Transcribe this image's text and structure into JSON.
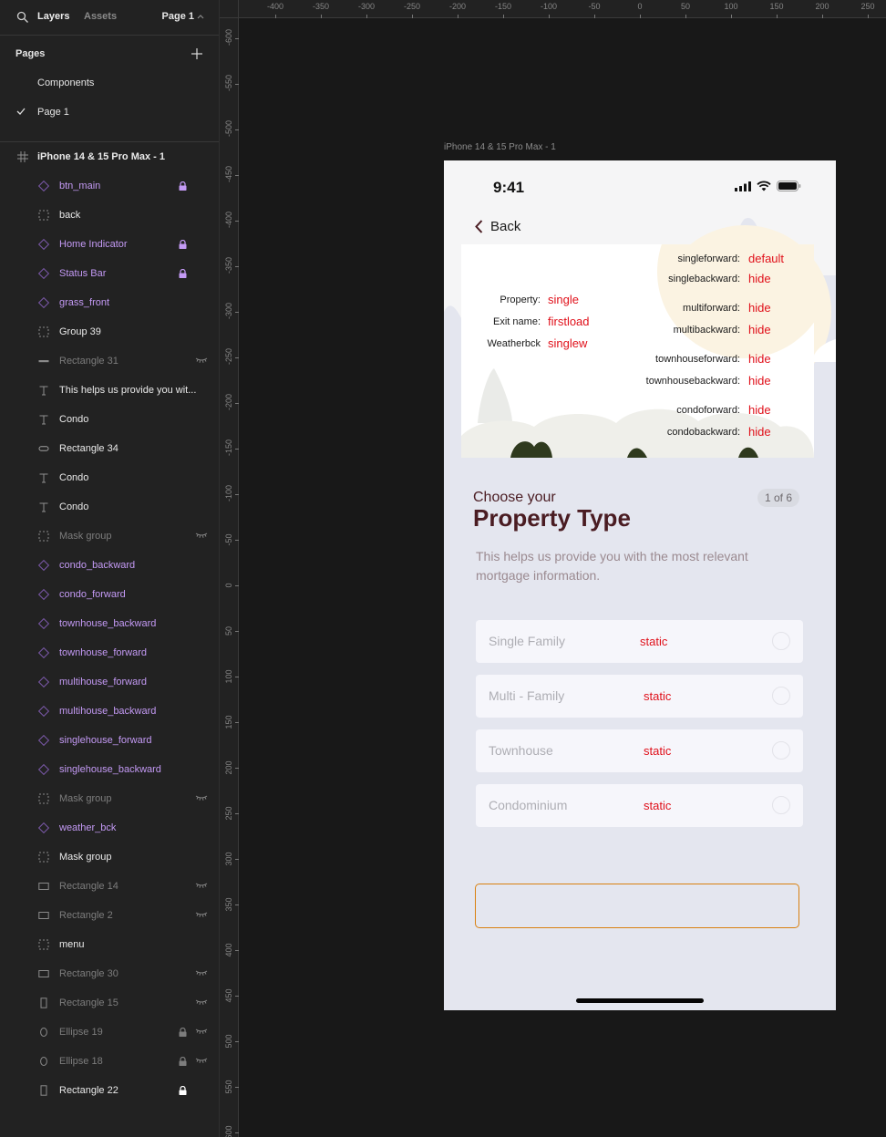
{
  "left_panel": {
    "tabs": {
      "layers": "Layers",
      "assets": "Assets"
    },
    "page_selector": {
      "label": "Page 1",
      "icon": "chevron-up-icon"
    },
    "pages": {
      "title": "Pages",
      "add_icon": "plus-icon",
      "items": [
        {
          "label": "Components",
          "selected": false
        },
        {
          "label": "Page 1",
          "selected": true
        }
      ]
    },
    "frame_layer": {
      "name": "iPhone 14 & 15 Pro Max - 1",
      "icon": "frame-hash-icon"
    },
    "layers": [
      {
        "name": "btn_main",
        "icon": "component-instance-icon",
        "style": "purple",
        "locked": true,
        "hidden": false
      },
      {
        "name": "back",
        "icon": "group-icon",
        "style": "white",
        "locked": false,
        "hidden": false
      },
      {
        "name": "Home Indicator",
        "icon": "component-instance-icon",
        "style": "purple",
        "locked": true,
        "hidden": false
      },
      {
        "name": "Status Bar",
        "icon": "component-instance-icon",
        "style": "purple",
        "locked": true,
        "hidden": false
      },
      {
        "name": "grass_front",
        "icon": "component-instance-icon",
        "style": "purple",
        "locked": false,
        "hidden": false
      },
      {
        "name": "Group 39",
        "icon": "group-icon",
        "style": "white",
        "locked": false,
        "hidden": false
      },
      {
        "name": "Rectangle 31",
        "icon": "line-rect-icon",
        "style": "dim",
        "locked": false,
        "hidden": true
      },
      {
        "name": "This helps us provide you wit...",
        "icon": "text-icon",
        "style": "white",
        "locked": false,
        "hidden": false
      },
      {
        "name": "Condo",
        "icon": "text-icon",
        "style": "white",
        "locked": false,
        "hidden": false
      },
      {
        "name": "Rectangle 34",
        "icon": "pill-rect-icon",
        "style": "white",
        "locked": false,
        "hidden": false
      },
      {
        "name": "Condo",
        "icon": "text-icon",
        "style": "white",
        "locked": false,
        "hidden": false
      },
      {
        "name": "Condo",
        "icon": "text-icon",
        "style": "white",
        "locked": false,
        "hidden": false
      },
      {
        "name": "Mask group",
        "icon": "group-icon",
        "style": "dim",
        "locked": false,
        "hidden": true
      },
      {
        "name": "condo_backward",
        "icon": "component-instance-icon",
        "style": "purple",
        "locked": false,
        "hidden": false
      },
      {
        "name": "condo_forward",
        "icon": "component-instance-icon",
        "style": "purple",
        "locked": false,
        "hidden": false
      },
      {
        "name": "townhouse_backward",
        "icon": "component-instance-icon",
        "style": "purple",
        "locked": false,
        "hidden": false
      },
      {
        "name": "townhouse_forward",
        "icon": "component-instance-icon",
        "style": "purple",
        "locked": false,
        "hidden": false
      },
      {
        "name": "multihouse_forward",
        "icon": "component-instance-icon",
        "style": "purple",
        "locked": false,
        "hidden": false
      },
      {
        "name": "multihouse_backward",
        "icon": "component-instance-icon",
        "style": "purple",
        "locked": false,
        "hidden": false
      },
      {
        "name": "singlehouse_forward",
        "icon": "component-instance-icon",
        "style": "purple",
        "locked": false,
        "hidden": false
      },
      {
        "name": "singlehouse_backward",
        "icon": "component-instance-icon",
        "style": "purple",
        "locked": false,
        "hidden": false
      },
      {
        "name": "Mask group",
        "icon": "group-icon",
        "style": "dim",
        "locked": false,
        "hidden": true
      },
      {
        "name": "weather_bck",
        "icon": "component-instance-icon",
        "style": "purple",
        "locked": false,
        "hidden": false
      },
      {
        "name": "Mask group",
        "icon": "group-icon",
        "style": "white",
        "locked": false,
        "hidden": false
      },
      {
        "name": "Rectangle 14",
        "icon": "rectangle-icon",
        "style": "dim",
        "locked": false,
        "hidden": true
      },
      {
        "name": "Rectangle 2",
        "icon": "rectangle-icon",
        "style": "dim",
        "locked": false,
        "hidden": true
      },
      {
        "name": "menu",
        "icon": "group-icon",
        "style": "white",
        "locked": false,
        "hidden": false
      },
      {
        "name": "Rectangle 30",
        "icon": "rectangle-icon",
        "style": "dim",
        "locked": false,
        "hidden": true
      },
      {
        "name": "Rectangle 15",
        "icon": "tall-rect-icon",
        "style": "dim",
        "locked": false,
        "hidden": true
      },
      {
        "name": "Ellipse 19",
        "icon": "ellipse-icon",
        "style": "dim",
        "locked": true,
        "hidden": true
      },
      {
        "name": "Ellipse 18",
        "icon": "ellipse-icon",
        "style": "dim",
        "locked": true,
        "hidden": true
      },
      {
        "name": "Rectangle 22",
        "icon": "tall-rect-icon",
        "style": "white",
        "locked": true,
        "hidden": false
      }
    ]
  },
  "rulers": {
    "top": [
      "-400",
      "-350",
      "-300",
      "-250",
      "-200",
      "-150",
      "-100",
      "-50",
      "0",
      "50",
      "100",
      "150",
      "200",
      "250"
    ],
    "left": [
      "-600",
      "-550",
      "-500",
      "-450",
      "-400",
      "-350",
      "-300",
      "-250",
      "-200",
      "-150",
      "-100",
      "-50",
      "0",
      "50",
      "100",
      "150",
      "200",
      "250",
      "300",
      "350",
      "400",
      "450",
      "500",
      "550",
      "600"
    ]
  },
  "canvas": {
    "frame_label": "iPhone 14 & 15 Pro Max - 1",
    "phone": {
      "status_bar": {
        "time": "9:41",
        "icons": [
          "cellular-signal-icon",
          "wifi-icon",
          "battery-icon"
        ]
      },
      "back_button": {
        "label": "Back",
        "icon": "chevron-left-icon"
      },
      "debug_panel": {
        "left": [
          {
            "key": "Property:",
            "value": "single"
          },
          {
            "key": "Exit name:",
            "value": "firstload"
          },
          {
            "key": "Weatherbck",
            "value": "singlew"
          }
        ],
        "right": [
          {
            "key": "singleforward:",
            "value": "default"
          },
          {
            "key": "singlebackward:",
            "value": "hide"
          },
          {
            "key": "multiforward:",
            "value": "hide"
          },
          {
            "key": "multibackward:",
            "value": "hide"
          },
          {
            "key": "townhouseforward:",
            "value": "hide"
          },
          {
            "key": "townhousebackward:",
            "value": "hide"
          },
          {
            "key": "condoforward:",
            "value": "hide"
          },
          {
            "key": "condobackward:",
            "value": "hide"
          }
        ]
      },
      "heading_small": "Choose your",
      "heading_big": "Property Type",
      "step_badge": "1 of 6",
      "subtitle": "This helps us provide you with the most relevant mortgage information.",
      "options": [
        {
          "label": "Single Family",
          "tag": "static",
          "selected": false
        },
        {
          "label": "Multi - Family",
          "tag": "static",
          "selected": false
        },
        {
          "label": "Townhouse",
          "tag": "static",
          "selected": false
        },
        {
          "label": "Condominium",
          "tag": "static",
          "selected": false
        }
      ],
      "main_button_label": ""
    }
  },
  "colors": {
    "panel_bg": "#222222",
    "canvas_bg": "#181818",
    "component_purple": "#c49af5",
    "heading_maroon": "#4a1c22",
    "debug_red": "#e0101a",
    "button_orange": "#d98010",
    "phone_bg": "#e4e6ef"
  }
}
